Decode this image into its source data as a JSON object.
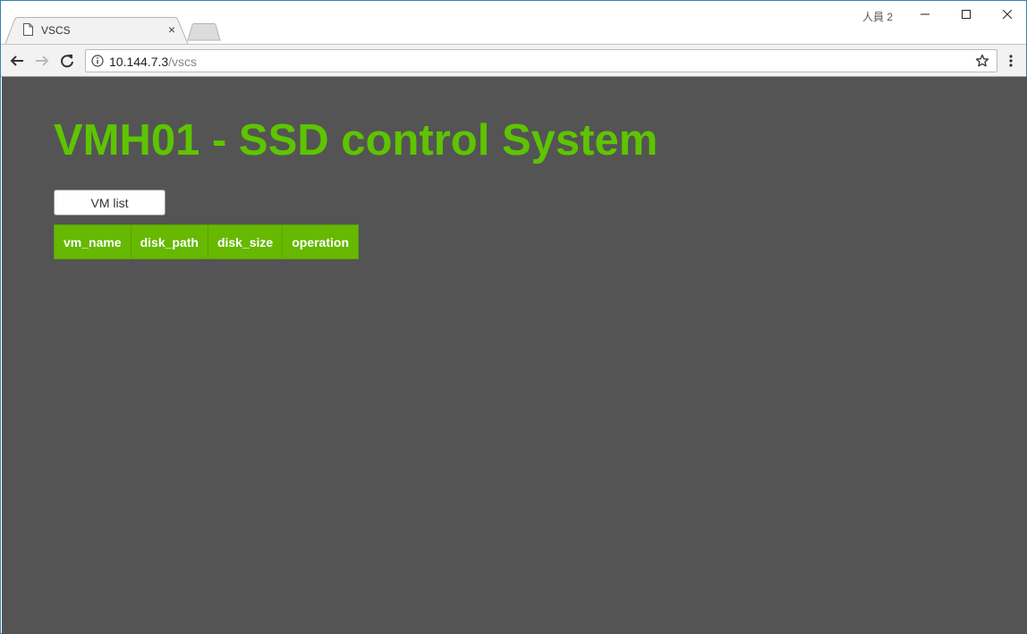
{
  "browser": {
    "tab_title": "VSCS",
    "tab_close": "×",
    "profile_label": "人員 2",
    "url_host": "10.144.7.3",
    "url_path": "/vscs"
  },
  "page": {
    "title": "VMH01 - SSD control System",
    "vm_list_button": "VM list",
    "table": {
      "columns": [
        "vm_name",
        "disk_path",
        "disk_size",
        "operation"
      ],
      "rows": []
    }
  },
  "colors": {
    "title_green": "#5ec400",
    "header_green": "#66b800",
    "page_background": "#545454"
  }
}
